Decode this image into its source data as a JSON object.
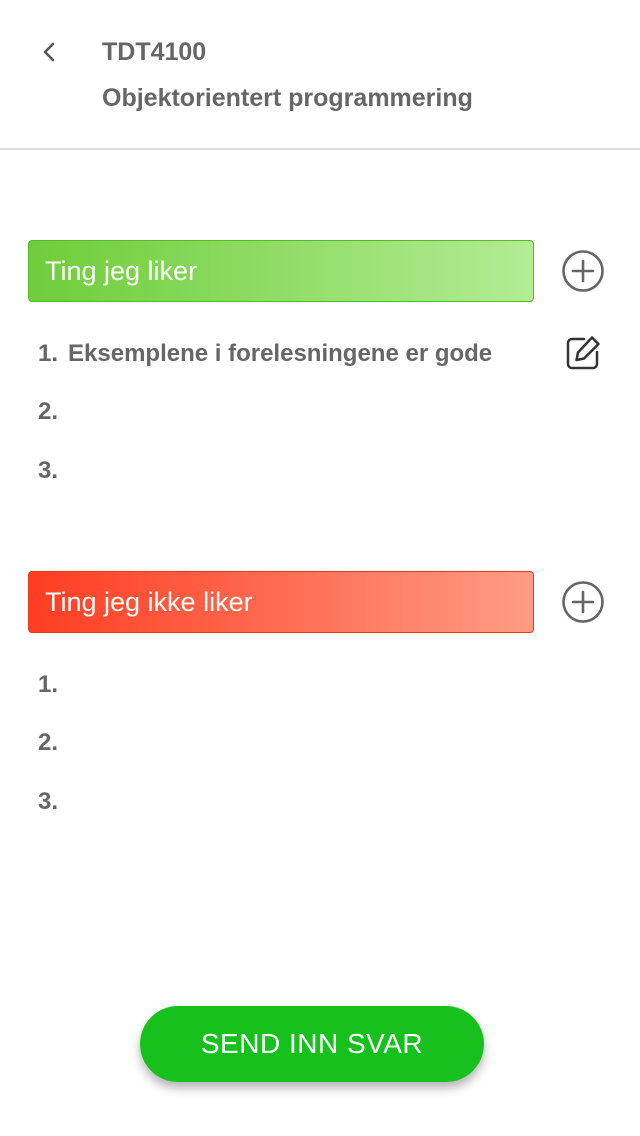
{
  "header": {
    "course_code": "TDT4100",
    "course_name": "Objektorientert programmering",
    "back_icon": "chevron-left-icon"
  },
  "likes": {
    "title": "Ting jeg liker",
    "add_icon": "add-circle-icon",
    "items": [
      {
        "number": "1.",
        "text": "Eksemplene i forelesningene er gode",
        "edit_icon": "edit-icon"
      },
      {
        "number": "2.",
        "text": ""
      },
      {
        "number": "3.",
        "text": ""
      }
    ],
    "colors": {
      "start": "#6fcd3a",
      "end": "#b3ec94"
    }
  },
  "dislikes": {
    "title": "Ting jeg ikke liker",
    "add_icon": "add-circle-icon",
    "items": [
      {
        "number": "1.",
        "text": ""
      },
      {
        "number": "2.",
        "text": ""
      },
      {
        "number": "3.",
        "text": ""
      }
    ],
    "colors": {
      "start": "#ff3d22",
      "end": "#ff9c84"
    }
  },
  "submit": {
    "label": "SEND INN SVAR",
    "color": "#17c11d"
  }
}
